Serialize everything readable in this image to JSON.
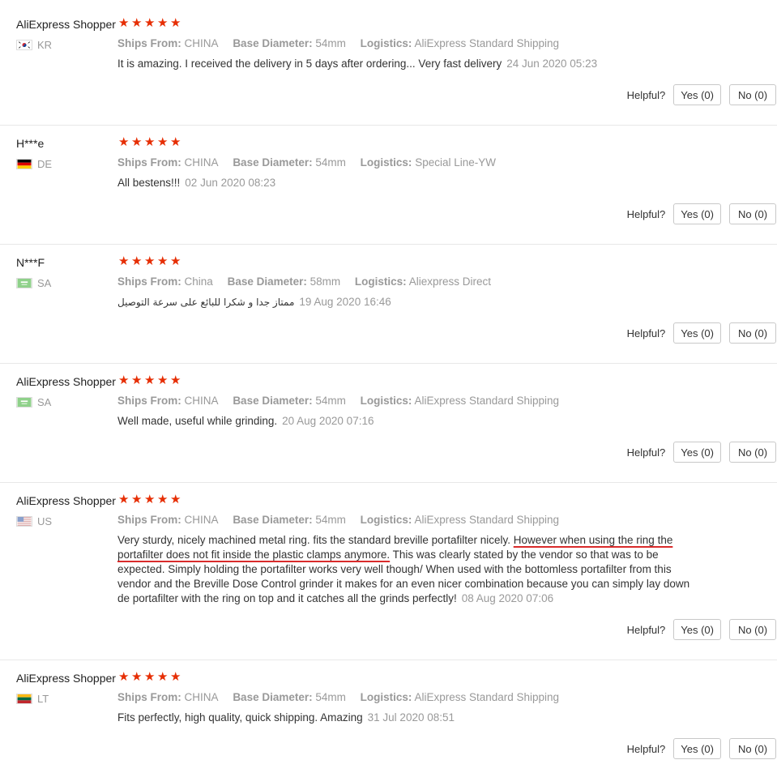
{
  "colors": {
    "star": "#e62e04",
    "underline": "#d92b2b",
    "muted": "#999999",
    "text": "#333333"
  },
  "helpful_label": "Helpful?",
  "reviews": [
    {
      "user": "AliExpress Shopper",
      "country": "KR",
      "flag_icon": "south-korea-flag-icon",
      "stars": 5,
      "props": [
        {
          "key": "Ships From:",
          "value": "CHINA"
        },
        {
          "key": "Base Diameter:",
          "value": "54mm"
        },
        {
          "key": "Logistics:",
          "value": "AliExpress Standard Shipping"
        }
      ],
      "text": "It is amazing. I received the delivery in 5 days after ordering... Very fast delivery",
      "date": "24 Jun 2020 05:23",
      "yes": "Yes (0)",
      "no": "No (0)"
    },
    {
      "user": "H***e",
      "country": "DE",
      "flag_icon": "germany-flag-icon",
      "stars": 5,
      "props": [
        {
          "key": "Ships From:",
          "value": "CHINA"
        },
        {
          "key": "Base Diameter:",
          "value": "54mm"
        },
        {
          "key": "Logistics:",
          "value": "Special Line-YW"
        }
      ],
      "text": "All bestens!!!",
      "date": "02 Jun 2020 08:23",
      "yes": "Yes (0)",
      "no": "No (0)"
    },
    {
      "user": "N***F",
      "country": "SA",
      "flag_icon": "saudi-arabia-flag-icon",
      "stars": 5,
      "props": [
        {
          "key": "Ships From:",
          "value": "China"
        },
        {
          "key": "Base Diameter:",
          "value": "58mm"
        },
        {
          "key": "Logistics:",
          "value": "Aliexpress Direct"
        }
      ],
      "text": "ممتاز جدا و شكرا للبائع على سرعة التوصيل",
      "date": "19 Aug 2020 16:46",
      "yes": "Yes (0)",
      "no": "No (0)"
    },
    {
      "user": "AliExpress Shopper",
      "country": "SA",
      "flag_icon": "saudi-arabia-flag-icon",
      "stars": 5,
      "props": [
        {
          "key": "Ships From:",
          "value": "CHINA"
        },
        {
          "key": "Base Diameter:",
          "value": "54mm"
        },
        {
          "key": "Logistics:",
          "value": "AliExpress Standard Shipping"
        }
      ],
      "text": "Well made, useful while grinding.",
      "date": "20 Aug 2020 07:16",
      "yes": "Yes (0)",
      "no": "No (0)"
    },
    {
      "user": "AliExpress Shopper",
      "country": "US",
      "flag_icon": "usa-flag-icon",
      "stars": 5,
      "props": [
        {
          "key": "Ships From:",
          "value": "CHINA"
        },
        {
          "key": "Base Diameter:",
          "value": "54mm"
        },
        {
          "key": "Logistics:",
          "value": "AliExpress Standard Shipping"
        }
      ],
      "text_before": "Very sturdy, nicely machined metal ring. fits the standard breville portafilter nicely. ",
      "text_underlined": "However when using the ring the portafilter does not fit inside the plastic clamps anymore.",
      "text_after": " This was clearly stated by the vendor so that was to be expected. Simply holding the portafilter works very well though/ When used with the bottomless portafilter from this vendor and the Breville Dose Control grinder it makes for an even nicer combination because you can simply lay down de portafilter with the ring on top and it catches all the grinds perfectly!",
      "date": "08 Aug 2020 07:06",
      "yes": "Yes (0)",
      "no": "No (0)"
    },
    {
      "user": "AliExpress Shopper",
      "country": "LT",
      "flag_icon": "lithuania-flag-icon",
      "stars": 5,
      "props": [
        {
          "key": "Ships From:",
          "value": "CHINA"
        },
        {
          "key": "Base Diameter:",
          "value": "54mm"
        },
        {
          "key": "Logistics:",
          "value": "AliExpress Standard Shipping"
        }
      ],
      "text": "Fits perfectly, high quality, quick shipping. Amazing",
      "date": "31 Jul 2020 08:51",
      "yes": "Yes (0)",
      "no": "No (0)"
    }
  ]
}
